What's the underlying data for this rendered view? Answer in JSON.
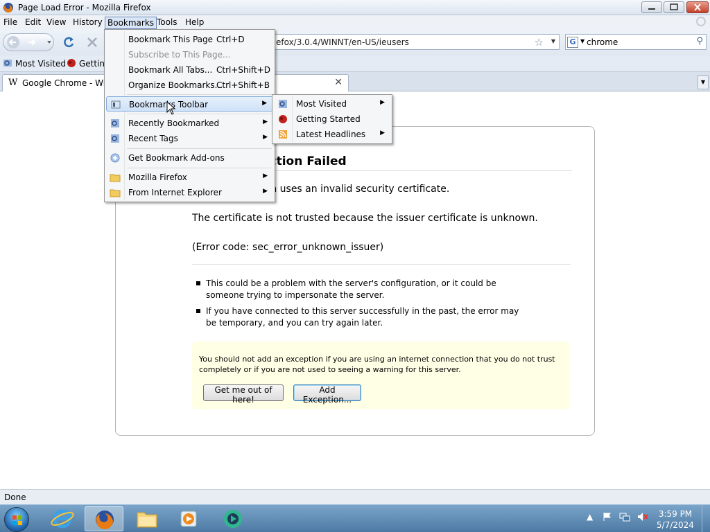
{
  "window": {
    "title": "Page Load Error - Mozilla Firefox"
  },
  "menubar": {
    "file": "File",
    "edit": "Edit",
    "view": "View",
    "history": "History",
    "bookmarks": "Bookmarks",
    "tools": "Tools",
    "help": "Help"
  },
  "navbar": {
    "url": "efox/3.0.4/WINNT/en-US/ieusers",
    "search_value": "chrome",
    "search_engine": "G"
  },
  "bookmarks_toolbar": {
    "most_visited": "Most Visited",
    "getting_started": "Gettin"
  },
  "tab": {
    "title": "Google Chrome - Wiki",
    "favicon": "W"
  },
  "bookmarks_menu": {
    "bookmark_this_page": "Bookmark This Page",
    "bookmark_this_page_shortcut": "Ctrl+D",
    "subscribe": "Subscribe to This Page...",
    "bookmark_all_tabs": "Bookmark All Tabs...",
    "bookmark_all_tabs_shortcut": "Ctrl+Shift+D",
    "organize": "Organize Bookmarks...",
    "organize_shortcut": "Ctrl+Shift+B",
    "bookmarks_toolbar": "Bookmarks Toolbar",
    "recently_bookmarked": "Recently Bookmarked",
    "recent_tags": "Recent Tags",
    "get_addons": "Get Bookmark Add-ons",
    "mozilla_firefox": "Mozilla Firefox",
    "from_ie": "From Internet Explorer"
  },
  "submenu": {
    "most_visited": "Most Visited",
    "getting_started": "Getting Started",
    "latest_headlines": "Latest Headlines"
  },
  "error_page": {
    "title_visible": "ection Failed",
    "line1_visible": "om uses an invalid security certificate.",
    "line2": "The certificate is not trusted because the issuer certificate is unknown.",
    "line3": "(Error code: sec_error_unknown_issuer)",
    "bullet1": "This could be a problem with the server's configuration, or it could be someone trying to impersonate the server.",
    "bullet2": "If you have connected to this server successfully in the past, the error may be temporary, and you can try again later.",
    "warning": "You should not add an exception if you are using an internet connection that you do not trust completely or if you are not used to seeing a warning for this server.",
    "btn_get_out": "Get me out of here!",
    "btn_add_exception": "Add Exception..."
  },
  "status": {
    "text": "Done"
  },
  "taskbar": {
    "time": "3:59 PM",
    "date": "5/7/2024"
  },
  "colors": {
    "menu_highlight": "#cfe2f8",
    "warning_bg": "#ffffe6",
    "taskbar": "#4d7aa4"
  }
}
